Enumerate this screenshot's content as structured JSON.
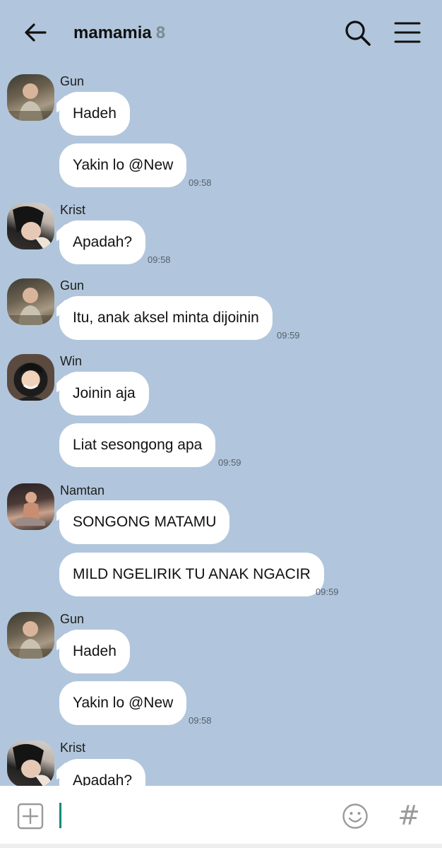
{
  "header": {
    "title": "mamamia",
    "member_count": "8",
    "back_icon": "arrow-left-icon",
    "search_icon": "search-icon",
    "menu_icon": "hamburger-menu-icon"
  },
  "messages": [
    {
      "sender": "Gun",
      "bubbles": [
        "Hadeh",
        "Yakin lo @New"
      ],
      "time": "09:58"
    },
    {
      "sender": "Krist",
      "bubbles": [
        "Apadah?"
      ],
      "time": "09:58"
    },
    {
      "sender": "Gun",
      "bubbles": [
        "Itu, anak aksel minta dijoinin"
      ],
      "time": "09:59"
    },
    {
      "sender": "Win",
      "bubbles": [
        "Joinin aja",
        "Liat sesongong apa"
      ],
      "time": "09:59"
    },
    {
      "sender": "Namtan",
      "bubbles": [
        "SONGONG MATAMU",
        "MILD NGELIRIK TU ANAK NGACIR"
      ],
      "time": "09:59"
    },
    {
      "sender": "Gun",
      "bubbles": [
        "Hadeh",
        "Yakin lo @New"
      ],
      "time": "09:58"
    },
    {
      "sender": "Krist",
      "bubbles": [
        "Apadah?"
      ],
      "time": ""
    }
  ],
  "input": {
    "add_icon": "plus-square-icon",
    "emoji_icon": "smiley-icon",
    "hashtag_label": "#"
  },
  "colors": {
    "background": "#b1c6dc",
    "bubble": "#ffffff",
    "cursor": "#0f8b78"
  }
}
